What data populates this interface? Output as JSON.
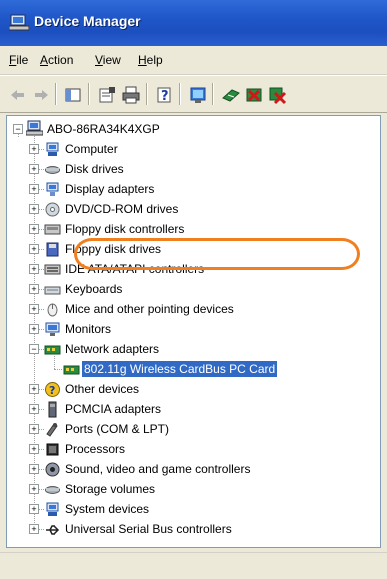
{
  "window": {
    "title": "Device Manager"
  },
  "menu": [
    {
      "label": "File",
      "accel": "F",
      "rest": "ile"
    },
    {
      "label": "Action",
      "accel": "A",
      "rest": "ction"
    },
    {
      "label": "View",
      "accel": "V",
      "rest": "iew"
    },
    {
      "label": "Help",
      "accel": "H",
      "rest": "elp"
    }
  ],
  "toolbar": {
    "buttons": [
      "back-arrow-icon",
      "forward-arrow-icon",
      "show-hide-tree-icon",
      "properties-icon",
      "print-icon",
      "help-icon",
      "scan-hardware-icon",
      "update-driver-icon",
      "disable-device-icon",
      "uninstall-device-icon"
    ]
  },
  "tree": {
    "root": "ABO-86RA34K4XGP",
    "categories": [
      {
        "label": "Computer",
        "icon": "computer-icon"
      },
      {
        "label": "Disk drives",
        "icon": "disk-drive-icon"
      },
      {
        "label": "Display adapters",
        "icon": "display-adapter-icon"
      },
      {
        "label": "DVD/CD-ROM drives",
        "icon": "cdrom-icon"
      },
      {
        "label": "Floppy disk controllers",
        "icon": "floppy-controller-icon"
      },
      {
        "label": "Floppy disk drives",
        "icon": "floppy-drive-icon"
      },
      {
        "label": "IDE ATA/ATAPI controllers",
        "icon": "ide-controller-icon"
      },
      {
        "label": "Keyboards",
        "icon": "keyboard-icon"
      },
      {
        "label": "Mice and other pointing devices",
        "icon": "mouse-icon"
      },
      {
        "label": "Monitors",
        "icon": "monitor-icon"
      },
      {
        "label": "Network adapters",
        "icon": "network-adapter-icon",
        "expanded": true
      },
      {
        "label": "Other devices",
        "icon": "unknown-device-icon"
      },
      {
        "label": "PCMCIA adapters",
        "icon": "pcmcia-icon"
      },
      {
        "label": "Ports (COM & LPT)",
        "icon": "port-icon"
      },
      {
        "label": "Processors",
        "icon": "processor-icon"
      },
      {
        "label": "Sound, video and game controllers",
        "icon": "sound-icon"
      },
      {
        "label": "Storage volumes",
        "icon": "storage-icon"
      },
      {
        "label": "System devices",
        "icon": "system-device-icon"
      },
      {
        "label": "Universal Serial Bus controllers",
        "icon": "usb-icon"
      }
    ],
    "network_child": {
      "label": "802.11g Wireless CardBus PC Card",
      "icon": "network-card-icon",
      "selected": true
    }
  },
  "colors": {
    "title_bar": "#1f56c8",
    "selection": "#316ac5",
    "highlight_ring": "#f07f20"
  }
}
